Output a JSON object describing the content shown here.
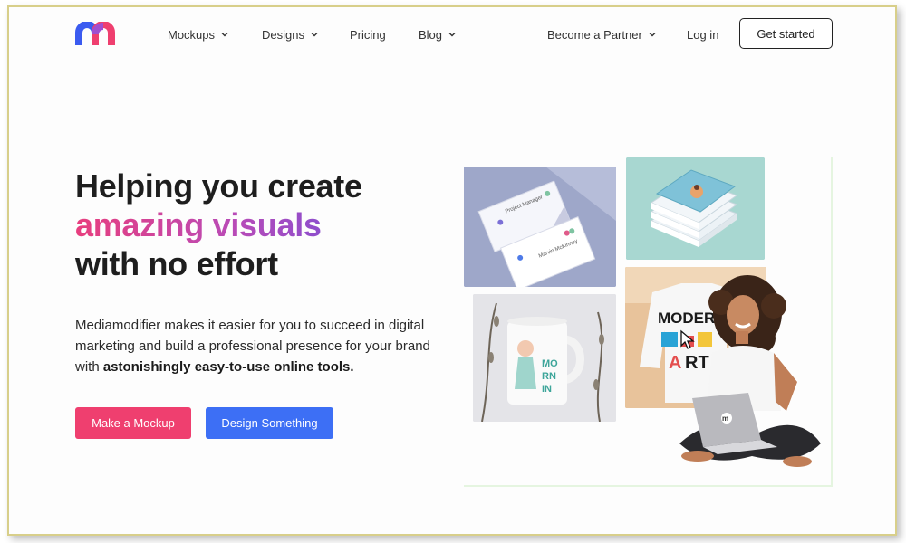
{
  "header": {
    "nav": {
      "mockups": "Mockups",
      "designs": "Designs",
      "pricing": "Pricing",
      "blog": "Blog",
      "partner": "Become a Partner",
      "login": "Log in"
    },
    "cta": "Get started"
  },
  "hero": {
    "headline_line1": "Helping you create",
    "headline_line2": "amazing visuals",
    "headline_line3": "with no effort",
    "description": "Mediamodifier makes it easier for you to succeed in digital marketing and build a professional presence for your brand with ",
    "description_bold": "astonishingly easy-to-use online tools.",
    "button_mockup": "Make a Mockup",
    "button_design": "Design Something"
  },
  "collage": {
    "card_label_1": "Project Manager",
    "card_label_2": "Marvin McKinney",
    "shirt_text": "MODERN ART"
  },
  "colors": {
    "brand_pink": "#ef3f6f",
    "brand_blue": "#3d6ff5",
    "gradient_start": "#e83e7e",
    "gradient_end": "#7a4fd6"
  },
  "icons": [
    "mediamodifier-logo",
    "chevron-down-icon"
  ]
}
